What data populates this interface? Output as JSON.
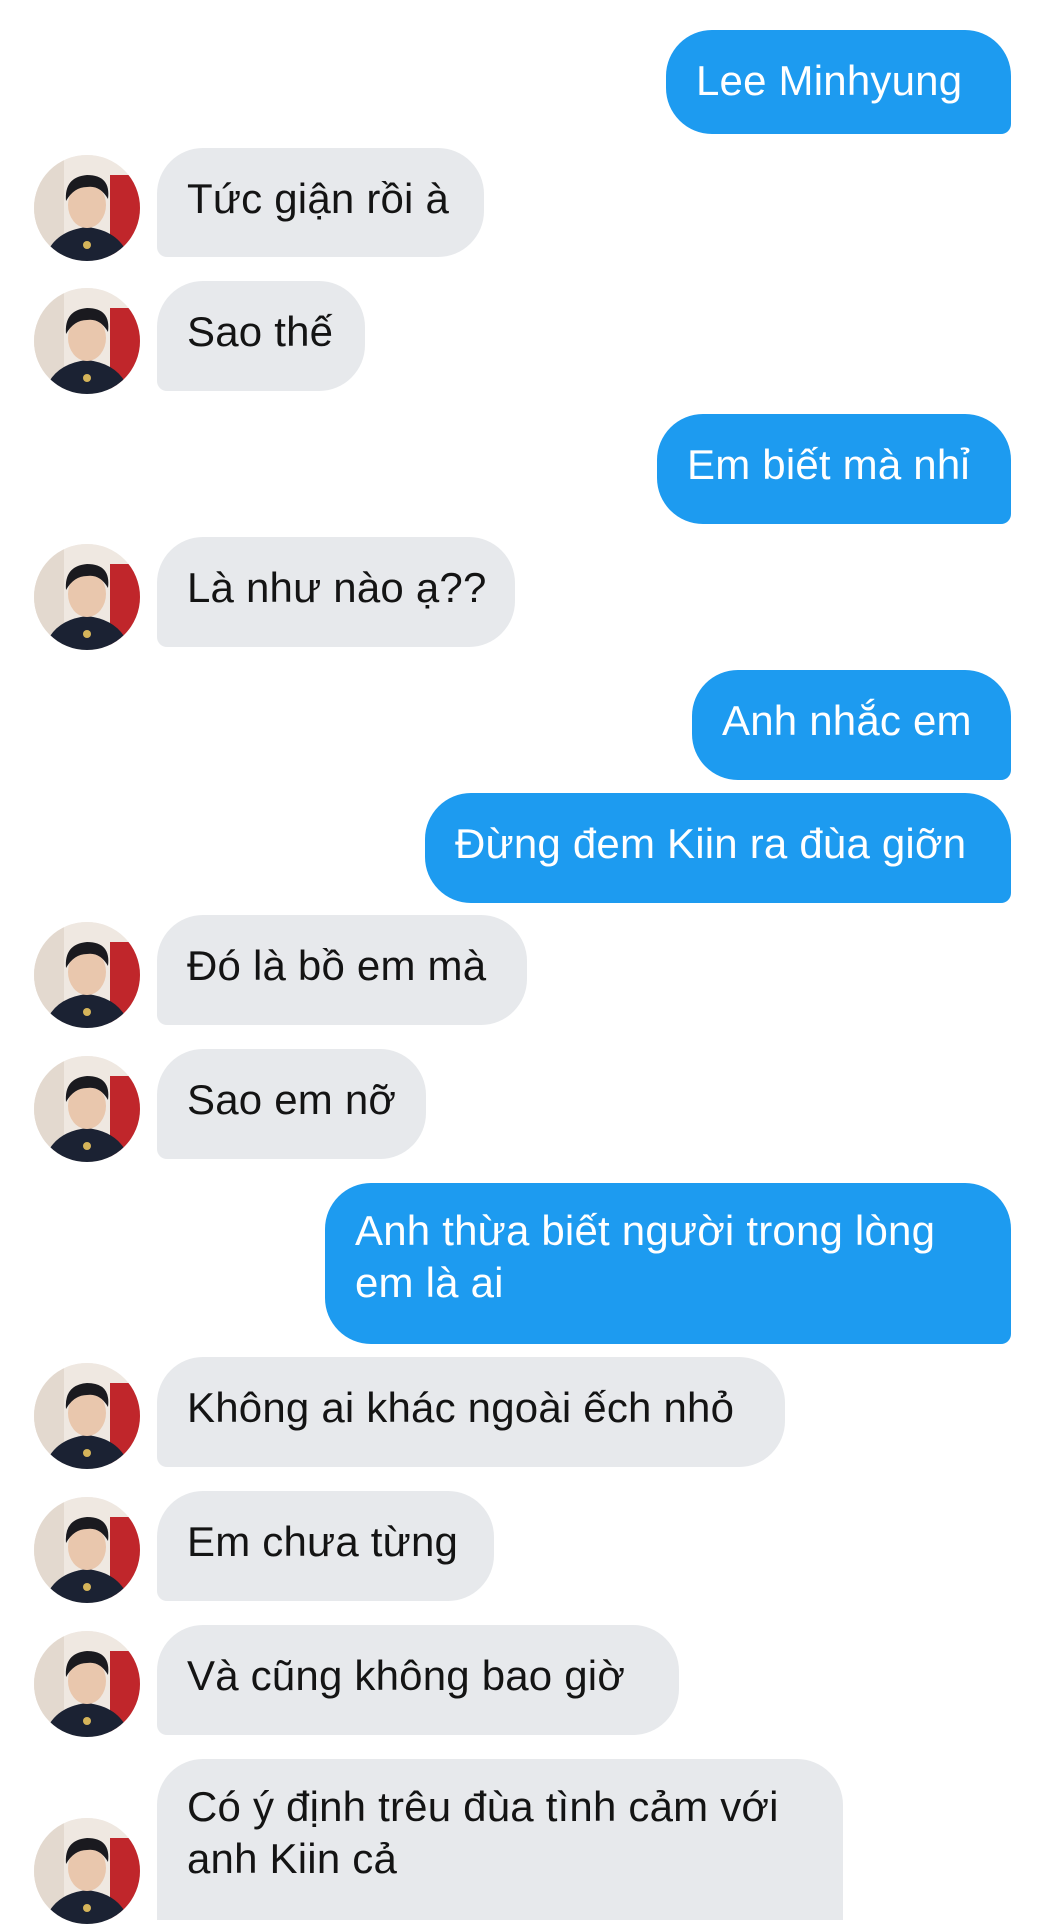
{
  "conversation": {
    "messages": [
      {
        "id": "m1",
        "sender": "me",
        "text": "Lee Minhyung"
      },
      {
        "id": "m2",
        "sender": "them",
        "text": "Tức giận rồi à"
      },
      {
        "id": "m3",
        "sender": "them",
        "text": "Sao thế"
      },
      {
        "id": "m4",
        "sender": "me",
        "text": "Em biết mà nhỉ"
      },
      {
        "id": "m5",
        "sender": "them",
        "text": "Là như nào ạ??"
      },
      {
        "id": "m6",
        "sender": "me",
        "text": "Anh nhắc em"
      },
      {
        "id": "m7",
        "sender": "me",
        "text": "Đừng đem Kiin ra đùa giỡn"
      },
      {
        "id": "m8",
        "sender": "them",
        "text": "Đó là bồ em mà"
      },
      {
        "id": "m9",
        "sender": "them",
        "text": "Sao em nỡ"
      },
      {
        "id": "m10",
        "sender": "me",
        "text": "Anh thừa biết người trong lòng em là ai"
      },
      {
        "id": "m11",
        "sender": "them",
        "text": "Không ai khác ngoài ếch nhỏ"
      },
      {
        "id": "m12",
        "sender": "them",
        "text": "Em chưa từng"
      },
      {
        "id": "m13",
        "sender": "them",
        "text": "Và cũng không bao giờ"
      },
      {
        "id": "m14",
        "sender": "them",
        "text": "Có ý định trêu đùa tình cảm với anh Kiin cả"
      }
    ]
  },
  "colors": {
    "sent_bubble": "#1d9bf0",
    "received_bubble": "#e7e9ec",
    "received_text": "#141414",
    "sent_text": "#ffffff"
  },
  "icons": {
    "avatar": "contact-avatar-icon"
  }
}
